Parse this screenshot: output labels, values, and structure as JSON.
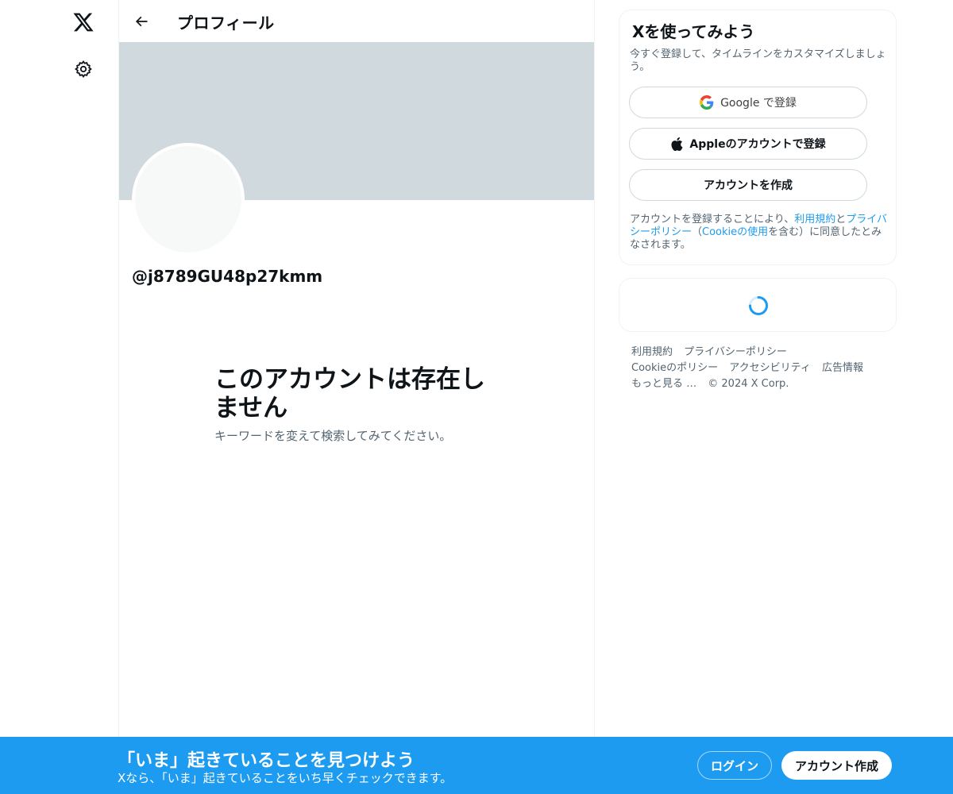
{
  "header": {
    "title": "プロフィール"
  },
  "profile": {
    "handle": "@j8789GU48p27kmm",
    "empty_title": "このアカウントは存在しません",
    "empty_subtitle": "キーワードを変えて検索してみてください。"
  },
  "signup": {
    "title": "Xを使ってみよう",
    "subtitle": "今すぐ登録して、タイムラインをカスタマイズしましょう。",
    "google_label": "Google で登録",
    "apple_label": "Appleのアカウントで登録",
    "create_label": "アカウントを作成",
    "terms_prefix": "アカウントを登録することにより、",
    "terms_link": "利用規約",
    "terms_and": "と",
    "privacy_link": "プライバシーポリシー",
    "terms_paren_open": "（",
    "cookie_link": "Cookieの使用",
    "terms_suffix": "を含む）に同意したとみなされます。"
  },
  "footer": {
    "links": [
      "利用規約",
      "プライバシーポリシー",
      "Cookieのポリシー",
      "アクセシビリティ",
      "広告情報",
      "もっと見る …"
    ],
    "copyright": "© 2024 X Corp."
  },
  "bottom_bar": {
    "title": "「いま」起きていることを見つけよう",
    "subtitle": "Xなら、「いま」起きていることをいち早くチェックできます。",
    "login_label": "ログイン",
    "signup_label": "アカウント作成"
  },
  "icons": {
    "logo": "x-logo-icon",
    "settings": "gear-icon",
    "back": "arrow-left-icon",
    "google": "google-icon",
    "apple": "apple-icon",
    "loading": "spinner-icon"
  },
  "colors": {
    "accent": "#1d9bf0",
    "banner": "#cfd9de",
    "text_primary": "#0f1419",
    "text_secondary": "#536471"
  }
}
